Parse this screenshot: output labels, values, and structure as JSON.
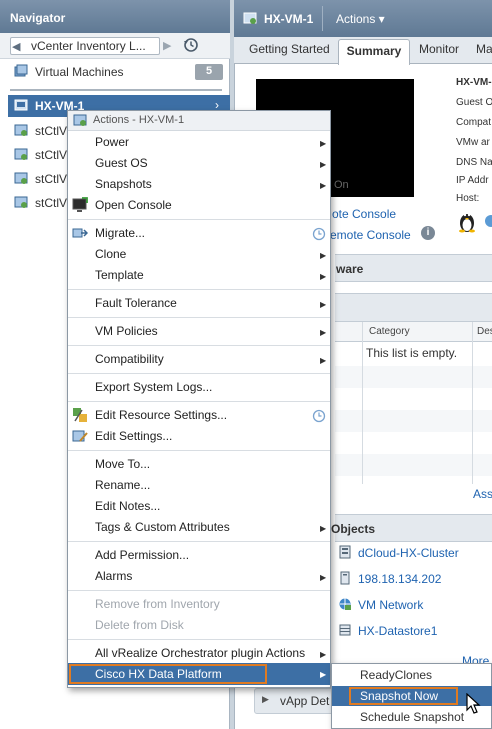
{
  "navigator": {
    "title": "Navigator",
    "breadcrumb": "vCenter Inventory L...",
    "virtual_machines_label": "Virtual Machines",
    "virtual_machines_count": "5",
    "selected_vm": "HX-VM-1",
    "tree_items": [
      "stCtlV",
      "stCtlV",
      "stCtlV",
      "stCtlV"
    ]
  },
  "header": {
    "vm_title": "HX-VM-1",
    "actions_label": "Actions ▾"
  },
  "tabs": [
    "Getting Started",
    "Summary",
    "Monitor",
    "Ma"
  ],
  "summary": {
    "console_state": "On",
    "launch_console": "ote Console",
    "launch_remote_console": "emote Console",
    "kv_labels": [
      "HX-VM-",
      "Guest O",
      "Compat",
      "VMw ar",
      "DNS Na",
      "IP Addr",
      "Host:"
    ],
    "hardware_header": "ware",
    "table_columns": [
      "Category",
      "Des"
    ],
    "empty_message": "This list is empty.",
    "assign_link": "Ass",
    "related_objects_header": "Objects",
    "related": [
      "dCloud-HX-Cluster",
      "198.18.134.202",
      "VM Network",
      "HX-Datastore1"
    ],
    "more_link": "More",
    "vapp_label": "vApp Det"
  },
  "context_menu": {
    "title": "Actions - HX-VM-1",
    "items": {
      "power": "Power",
      "guest_os": "Guest OS",
      "snapshots": "Snapshots",
      "open_console": "Open Console",
      "migrate": "Migrate...",
      "clone": "Clone",
      "template": "Template",
      "fault_tolerance": "Fault Tolerance",
      "vm_policies": "VM Policies",
      "compatibility": "Compatibility",
      "export_logs": "Export System Logs...",
      "edit_resource": "Edit Resource Settings...",
      "edit_settings": "Edit Settings...",
      "move_to": "Move To...",
      "rename": "Rename...",
      "edit_notes": "Edit Notes...",
      "tags": "Tags & Custom Attributes",
      "add_permission": "Add Permission...",
      "alarms": "Alarms",
      "remove_inventory": "Remove from Inventory",
      "delete_disk": "Delete from Disk",
      "vro_actions": "All vRealize Orchestrator plugin Actions",
      "cisco_hx": "Cisco HX Data Platform"
    }
  },
  "submenu": {
    "ready_clones": "ReadyClones",
    "snapshot_now": "Snapshot Now",
    "schedule_snapshot": "Schedule Snapshot"
  },
  "colors": {
    "header_blue": "#6a84a0",
    "selection_blue": "#3d6fa5",
    "highlight_orange": "#e07b22",
    "link_blue": "#1f63b0"
  }
}
